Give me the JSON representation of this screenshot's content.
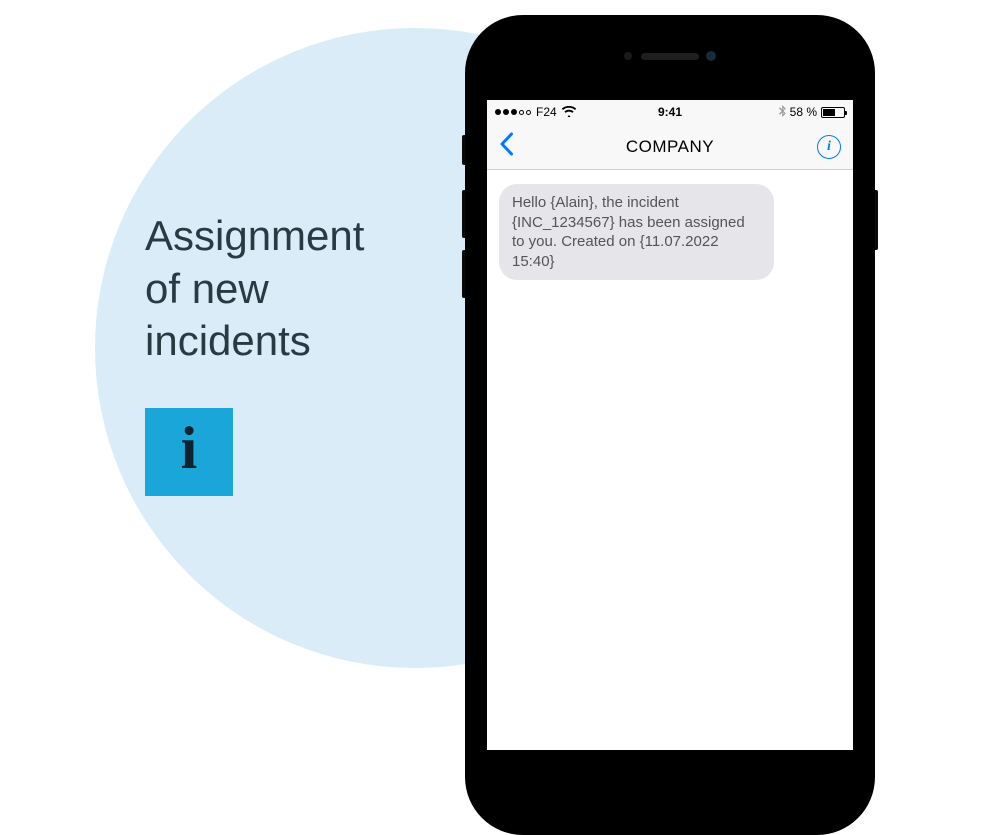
{
  "heading": "Assignment of new incidents",
  "info_icon_glyph": "i",
  "phone": {
    "status": {
      "carrier": "F24",
      "time": "9:41",
      "battery_pct": "58 %"
    },
    "nav": {
      "title": "COMPANY",
      "info_glyph": "i"
    },
    "message": "Hello {Alain}, the incident {INC_1234567} has been assigned  to you. Created on {11.07.2022 15:40}"
  }
}
